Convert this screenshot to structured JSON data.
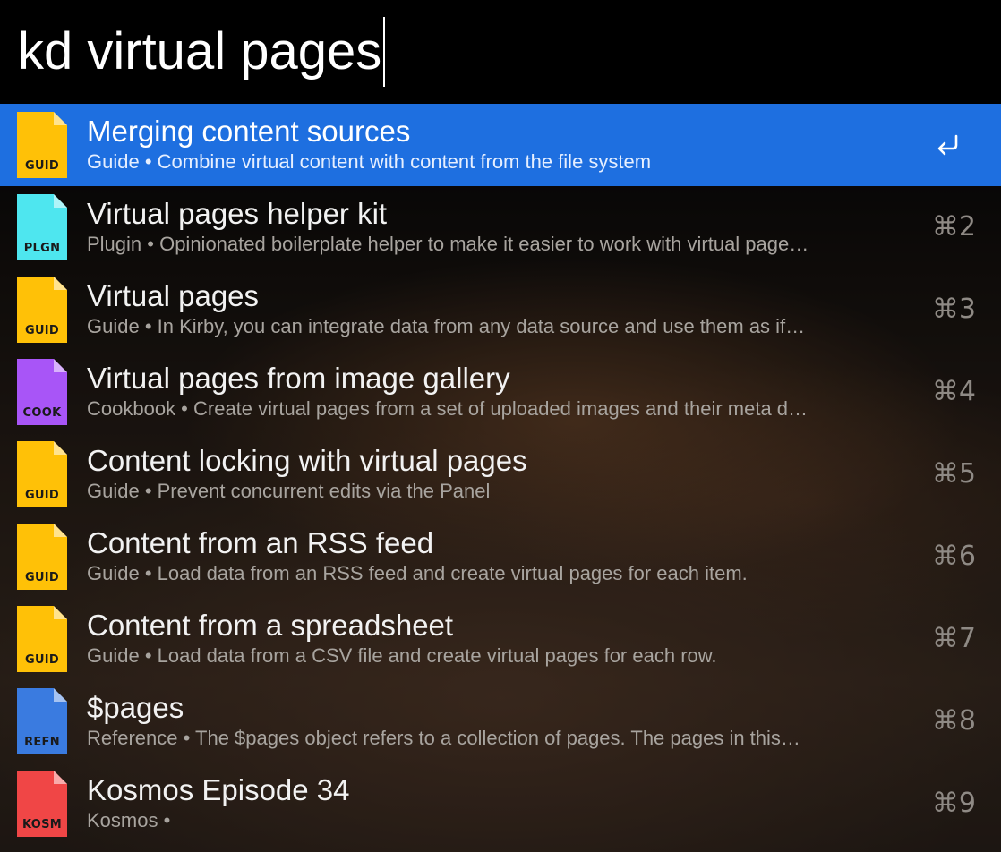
{
  "search": {
    "query": "kd virtual pages"
  },
  "colors": {
    "selected_bg": "#1e6fe0",
    "guide": "#ffc107",
    "plugin": "#4ee6ef",
    "cookbook": "#a855f7",
    "reference": "#3a7be0",
    "kosmos": "#f04646"
  },
  "results": [
    {
      "title": "Merging content sources",
      "subtitle": "Guide • Combine virtual content with content from the file system",
      "tag": "GUID",
      "icon": "guide-file-icon",
      "color": "#ffc107",
      "shortcut": "",
      "selected": true
    },
    {
      "title": "Virtual pages helper kit",
      "subtitle": "Plugin • Opinionated boilerplate helper to make it easier to work with virtual page…",
      "tag": "PLGN",
      "icon": "plugin-file-icon",
      "color": "#4ee6ef",
      "shortcut": "⌘2",
      "selected": false
    },
    {
      "title": "Virtual pages",
      "subtitle": "Guide • In Kirby, you can integrate data from any data source and use them as if…",
      "tag": "GUID",
      "icon": "guide-file-icon",
      "color": "#ffc107",
      "shortcut": "⌘3",
      "selected": false
    },
    {
      "title": "Virtual pages from image gallery",
      "subtitle": "Cookbook • Create virtual pages from a set of uploaded images and their meta d…",
      "tag": "COOK",
      "icon": "cookbook-file-icon",
      "color": "#a855f7",
      "shortcut": "⌘4",
      "selected": false
    },
    {
      "title": "Content locking with virtual pages",
      "subtitle": "Guide • Prevent concurrent edits via the Panel",
      "tag": "GUID",
      "icon": "guide-file-icon",
      "color": "#ffc107",
      "shortcut": "⌘5",
      "selected": false
    },
    {
      "title": "Content from an RSS feed",
      "subtitle": "Guide • Load data from an RSS feed and create virtual pages for each item.",
      "tag": "GUID",
      "icon": "guide-file-icon",
      "color": "#ffc107",
      "shortcut": "⌘6",
      "selected": false
    },
    {
      "title": "Content from a spreadsheet",
      "subtitle": "Guide • Load data from a CSV file and create virtual pages for each row.",
      "tag": "GUID",
      "icon": "guide-file-icon",
      "color": "#ffc107",
      "shortcut": "⌘7",
      "selected": false
    },
    {
      "title": "$pages",
      "subtitle": "Reference • The $pages object refers to a collection of pages. The pages in this…",
      "tag": "REFN",
      "icon": "reference-file-icon",
      "color": "#3a7be0",
      "shortcut": "⌘8",
      "selected": false
    },
    {
      "title": "Kosmos Episode 34",
      "subtitle": "Kosmos •",
      "tag": "KOSM",
      "icon": "kosmos-file-icon",
      "color": "#f04646",
      "shortcut": "⌘9",
      "selected": false
    }
  ]
}
